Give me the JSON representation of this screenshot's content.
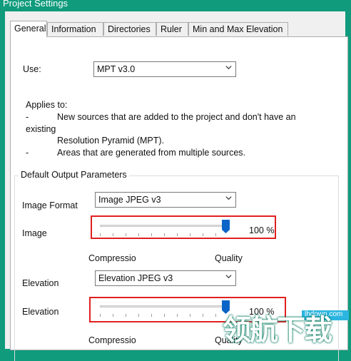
{
  "window": {
    "title": "Project Settings"
  },
  "tabs": [
    {
      "label": "General",
      "active": true
    },
    {
      "label": "Information",
      "active": false
    },
    {
      "label": "Directories",
      "active": false
    },
    {
      "label": "Ruler",
      "active": false
    },
    {
      "label": "Min and Max Elevation",
      "active": false
    }
  ],
  "general": {
    "use_label": "Use:",
    "use_value": "MPT v3.0",
    "applies_to": "Applies to:",
    "bullet_1_dash": "-",
    "bullet_1_line1": "New sources that are added to the project and don't have an",
    "bullet_1_line2": "existing",
    "bullet_1_line3": "Resolution Pyramid (MPT).",
    "bullet_2_dash": "-",
    "bullet_2_text": "Areas that are generated from multiple sources."
  },
  "output_params": {
    "group_title": "Default Output Parameters",
    "image_format_label": "Image Format",
    "image_format_value": "Image JPEG v3",
    "image_label": "Image",
    "image_quality_text": "100 %",
    "image_quality_fraction": 1.0,
    "compression_label": "Compressio",
    "quality_label": "Quality",
    "elevation_label": "Elevation",
    "elevation_format_value": "Elevation JPEG v3",
    "elevation_quality_label": "Elevation",
    "elevation_quality_text": "100 %",
    "elevation_quality_fraction": 1.0,
    "compression_label_2": "Compressio",
    "quality_label_2": "Quality"
  },
  "watermark": {
    "site": "lhdown.com",
    "brand": "领航下载"
  },
  "colors": {
    "title_bar": "#0f9b7c",
    "highlight_box": "#e02020",
    "slider_thumb": "#0a64c8"
  },
  "icons": {
    "dropdown": "chevron-down-icon",
    "slider": "slider-thumb-icon"
  }
}
